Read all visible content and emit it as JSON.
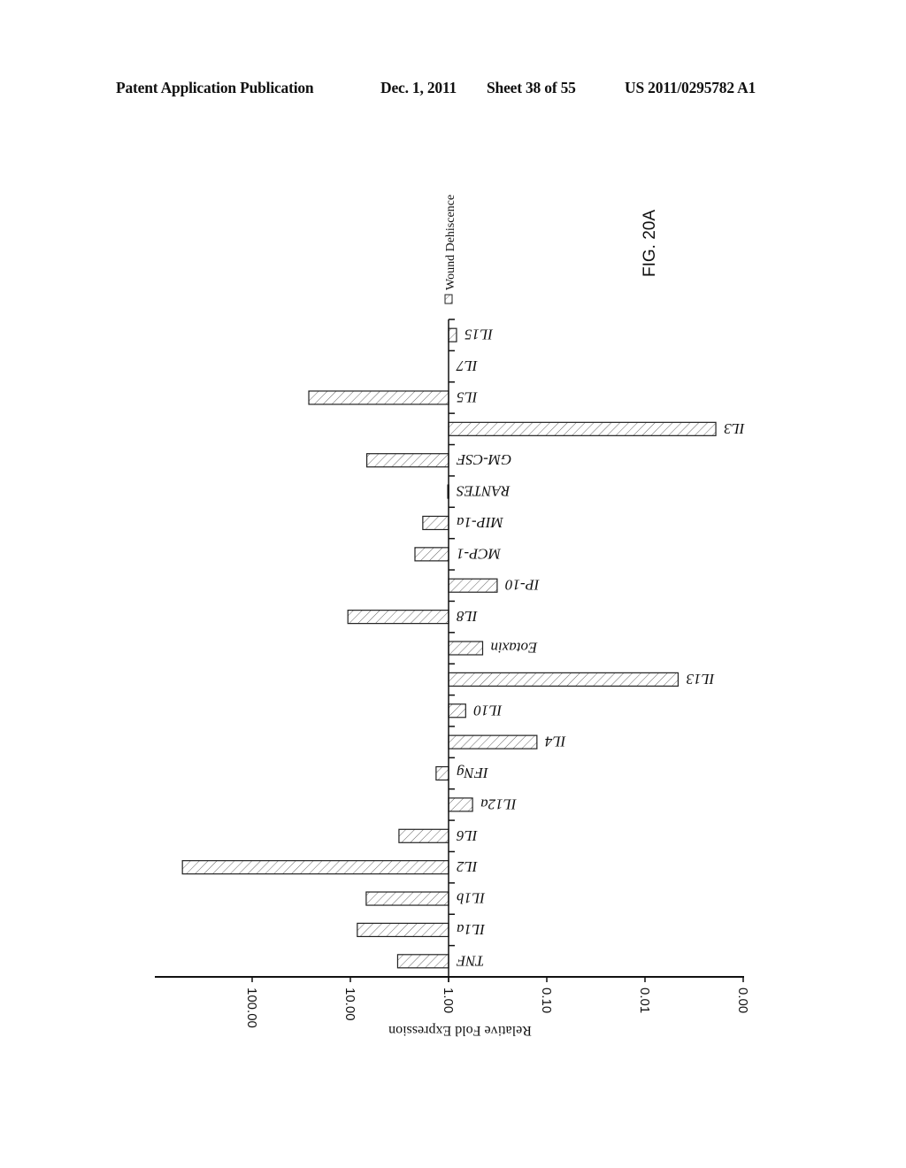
{
  "header": {
    "publication": "Patent Application Publication",
    "date": "Dec. 1, 2011",
    "sheet": "Sheet 38 of 55",
    "number": "US 2011/0295782 A1"
  },
  "figure_label": "FIG. 20A",
  "colors": {
    "ink": "#111111",
    "bar_fill": "#ffffff",
    "hatch": "#555555"
  },
  "chart_data": {
    "type": "bar",
    "orientation": "horizontal (page rotated 90°)",
    "scale": "log10",
    "baseline": 1.0,
    "title": "",
    "ylabel": "Relative Fold Expression",
    "xlabel": "",
    "tick_values": [
      100,
      10,
      1,
      0.1,
      0.01,
      0.001
    ],
    "tick_labels": [
      "100.00",
      "10.00",
      "1.00",
      "0.10",
      "0.01",
      "0.00"
    ],
    "value_range": [
      1000,
      0.001
    ],
    "grid": false,
    "legend": {
      "position": "top",
      "entries": [
        "Wound Dehiscence"
      ]
    },
    "categories": [
      "TNF",
      "IL1a",
      "IL1b",
      "IL2",
      "IL6",
      "IL12a",
      "IFNg",
      "IL4",
      "IL10",
      "IL13",
      "Eotaxin",
      "IL8",
      "IP-10",
      "MCP-1",
      "MIP-1a",
      "RANTES",
      "GM-CSF",
      "IL3",
      "IL5",
      "IL7",
      "IL15"
    ],
    "series": [
      {
        "name": "Wound Dehiscence",
        "values": [
          3.3,
          8.5,
          6.9,
          513,
          3.2,
          0.57,
          1.34,
          0.126,
          0.67,
          0.0046,
          0.45,
          10.6,
          0.32,
          2.2,
          1.83,
          1.02,
          6.8,
          0.0019,
          26.5,
          1.0,
          0.83
        ]
      }
    ]
  }
}
